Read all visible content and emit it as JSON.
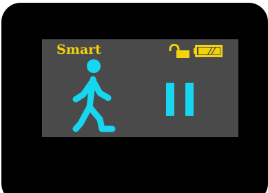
{
  "display": {
    "mode_label": "Smart",
    "lock_state": "unlocked",
    "battery_level": 1.0,
    "activity": "walking",
    "playback_state": "paused"
  },
  "icons": {
    "lock": "unlocked-padlock-icon",
    "battery": "battery-icon",
    "activity": "walking-person-icon",
    "playback": "pause-icon"
  },
  "colors": {
    "device_body": "#000000",
    "screen_background": "#4a4a4a",
    "label_yellow": "#f2d30d",
    "accent_cyan": "#16d6f0"
  }
}
